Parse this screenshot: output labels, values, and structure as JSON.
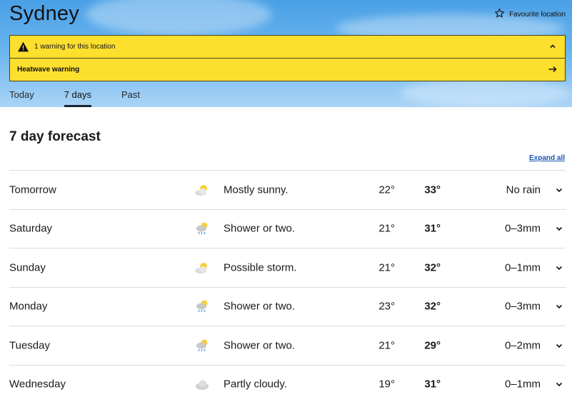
{
  "header": {
    "city": "Sydney",
    "favourite_label": "Favourite location"
  },
  "warnings": {
    "summary": "1 warning for this location",
    "items": [
      {
        "label": "Heatwave warning"
      }
    ]
  },
  "tabs": [
    {
      "label": "Today",
      "active": false
    },
    {
      "label": "7 days",
      "active": true
    },
    {
      "label": "Past",
      "active": false
    }
  ],
  "forecast": {
    "title": "7 day forecast",
    "expand_label": "Expand all",
    "days": [
      {
        "day": "Tomorrow",
        "icon": "mostly-sunny-icon",
        "desc": "Mostly sunny.",
        "min": "22°",
        "max": "33°",
        "rain": "No rain"
      },
      {
        "day": "Saturday",
        "icon": "shower-icon",
        "desc": "Shower or two.",
        "min": "21°",
        "max": "31°",
        "rain": "0–3mm"
      },
      {
        "day": "Sunday",
        "icon": "mostly-sunny-icon",
        "desc": "Possible storm.",
        "min": "21°",
        "max": "32°",
        "rain": "0–1mm"
      },
      {
        "day": "Monday",
        "icon": "shower-icon",
        "desc": "Shower or two.",
        "min": "23°",
        "max": "32°",
        "rain": "0–3mm"
      },
      {
        "day": "Tuesday",
        "icon": "shower-icon",
        "desc": "Shower or two.",
        "min": "21°",
        "max": "29°",
        "rain": "0–2mm"
      },
      {
        "day": "Wednesday",
        "icon": "partly-cloudy-icon",
        "desc": "Partly cloudy.",
        "min": "19°",
        "max": "31°",
        "rain": "0–1mm"
      }
    ]
  },
  "colors": {
    "warning_yellow": "#fddf2e",
    "link_blue": "#1a55b5",
    "sky_top": "#4aa0e6",
    "sky_bottom": "#a9d3f6"
  }
}
